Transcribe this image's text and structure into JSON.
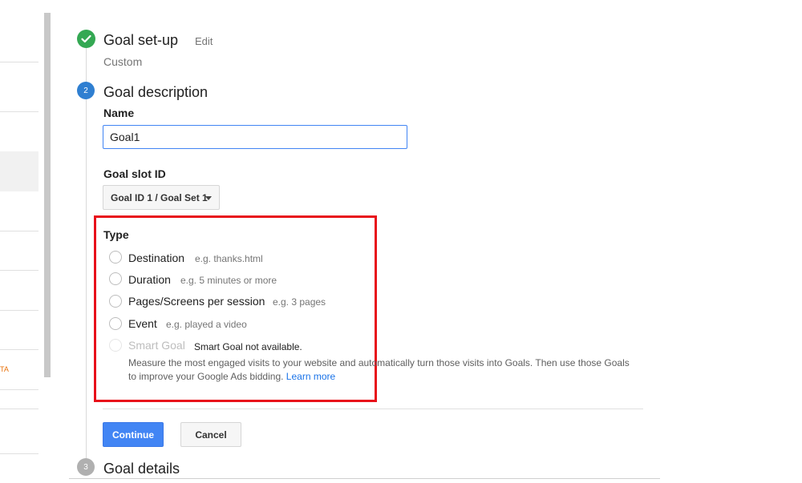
{
  "sidebar": {
    "partial_text": "TA"
  },
  "steps": {
    "setup": {
      "title": "Goal set-up",
      "edit_label": "Edit",
      "summary": "Custom"
    },
    "description": {
      "number": "2",
      "title": "Goal description"
    },
    "details": {
      "number": "3",
      "title": "Goal details"
    }
  },
  "form": {
    "name_label": "Name",
    "name_value": "Goal1",
    "slot_label": "Goal slot ID",
    "slot_value": "Goal ID 1 / Goal Set 1",
    "type_label": "Type",
    "options": [
      {
        "label": "Destination",
        "example": "e.g. thanks.html"
      },
      {
        "label": "Duration",
        "example": "e.g. 5 minutes or more"
      },
      {
        "label": "Pages/Screens per session",
        "example": "e.g. 3 pages"
      },
      {
        "label": "Event",
        "example": "e.g. played a video"
      },
      {
        "label": "Smart Goal",
        "example": "Smart Goal not available."
      }
    ],
    "smart_description": "Measure the most engaged visits to your website and automatically turn those visits into Goals. Then use those Goals to improve your Google Ads bidding.",
    "learn_more": "Learn more"
  },
  "actions": {
    "continue_label": "Continue",
    "cancel_label": "Cancel"
  },
  "colors": {
    "accent": "#4285f4",
    "success": "#34a853",
    "highlight": "#e8101a"
  }
}
